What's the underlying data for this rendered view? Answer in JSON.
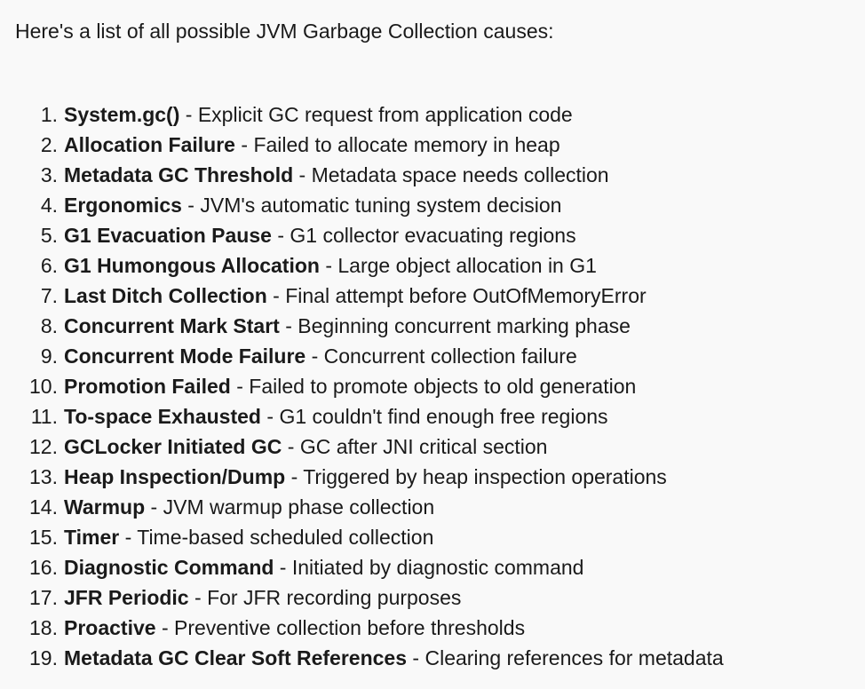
{
  "intro": "Here's a list of all possible JVM Garbage Collection causes:",
  "separator": " - ",
  "items": [
    {
      "num": "1.",
      "name": "System.gc()",
      "desc": "Explicit GC request from application code"
    },
    {
      "num": "2.",
      "name": "Allocation Failure",
      "desc": "Failed to allocate memory in heap"
    },
    {
      "num": "3.",
      "name": "Metadata GC Threshold",
      "desc": "Metadata space needs collection"
    },
    {
      "num": "4.",
      "name": "Ergonomics",
      "desc": "JVM's automatic tuning system decision"
    },
    {
      "num": "5.",
      "name": "G1 Evacuation Pause",
      "desc": "G1 collector evacuating regions"
    },
    {
      "num": "6.",
      "name": "G1 Humongous Allocation",
      "desc": "Large object allocation in G1"
    },
    {
      "num": "7.",
      "name": "Last Ditch Collection",
      "desc": "Final attempt before OutOfMemoryError"
    },
    {
      "num": "8.",
      "name": "Concurrent Mark Start",
      "desc": "Beginning concurrent marking phase"
    },
    {
      "num": "9.",
      "name": "Concurrent Mode Failure",
      "desc": "Concurrent collection failure"
    },
    {
      "num": "10.",
      "name": "Promotion Failed",
      "desc": "Failed to promote objects to old generation"
    },
    {
      "num": "11.",
      "name": "To-space Exhausted",
      "desc": "G1 couldn't find enough free regions"
    },
    {
      "num": "12.",
      "name": "GCLocker Initiated GC",
      "desc": "GC after JNI critical section"
    },
    {
      "num": "13.",
      "name": "Heap Inspection/Dump",
      "desc": "Triggered by heap inspection operations"
    },
    {
      "num": "14.",
      "name": "Warmup",
      "desc": "JVM warmup phase collection"
    },
    {
      "num": "15.",
      "name": "Timer",
      "desc": "Time-based scheduled collection"
    },
    {
      "num": "16.",
      "name": "Diagnostic Command",
      "desc": "Initiated by diagnostic command"
    },
    {
      "num": "17.",
      "name": "JFR Periodic",
      "desc": "For JFR recording purposes"
    },
    {
      "num": "18.",
      "name": "Proactive",
      "desc": "Preventive collection before thresholds"
    },
    {
      "num": "19.",
      "name": "Metadata GC Clear Soft References",
      "desc": "Clearing references for metadata"
    }
  ]
}
